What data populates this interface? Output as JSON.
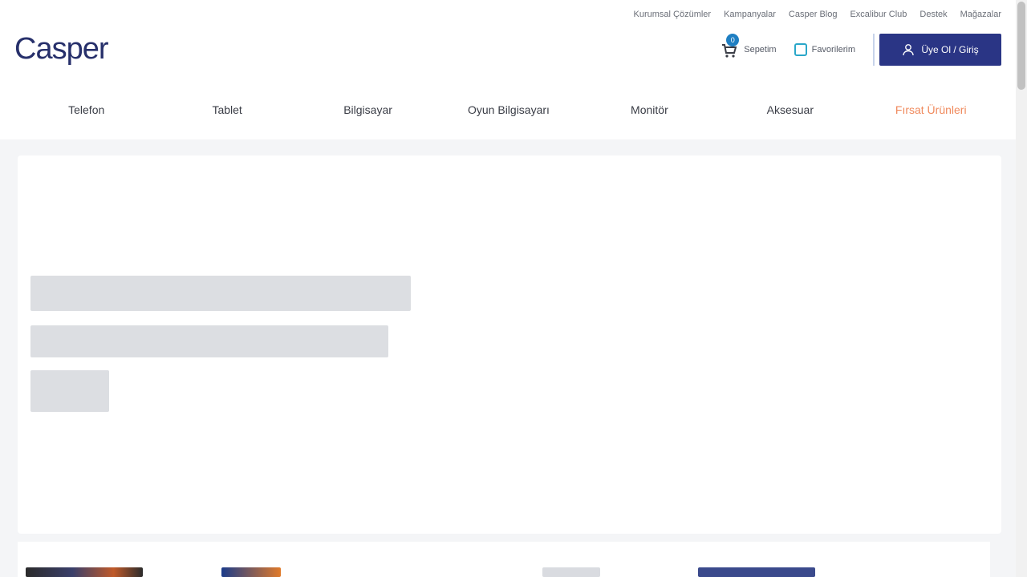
{
  "header": {
    "logo": "Casper",
    "top_links": [
      "Kurumsal Çözümler",
      "Kampanyalar",
      "Casper Blog",
      "Excalibur Club",
      "Destek",
      "Mağazalar"
    ],
    "cart": {
      "label": "Sepetim",
      "count": "0"
    },
    "favorites": {
      "label": "Favorilerim"
    },
    "login_label": "Üye Ol / Giriş"
  },
  "nav": {
    "items": [
      "Telefon",
      "Tablet",
      "Bilgisayar",
      "Oyun Bilgisayarı",
      "Monitör",
      "Aksesuar",
      "Fırsat Ürünleri"
    ]
  },
  "colors": {
    "brand": "#27306b",
    "login_button": "#2a3585",
    "accent_nav": "#f08a5d",
    "badge": "#1f7fc2"
  }
}
